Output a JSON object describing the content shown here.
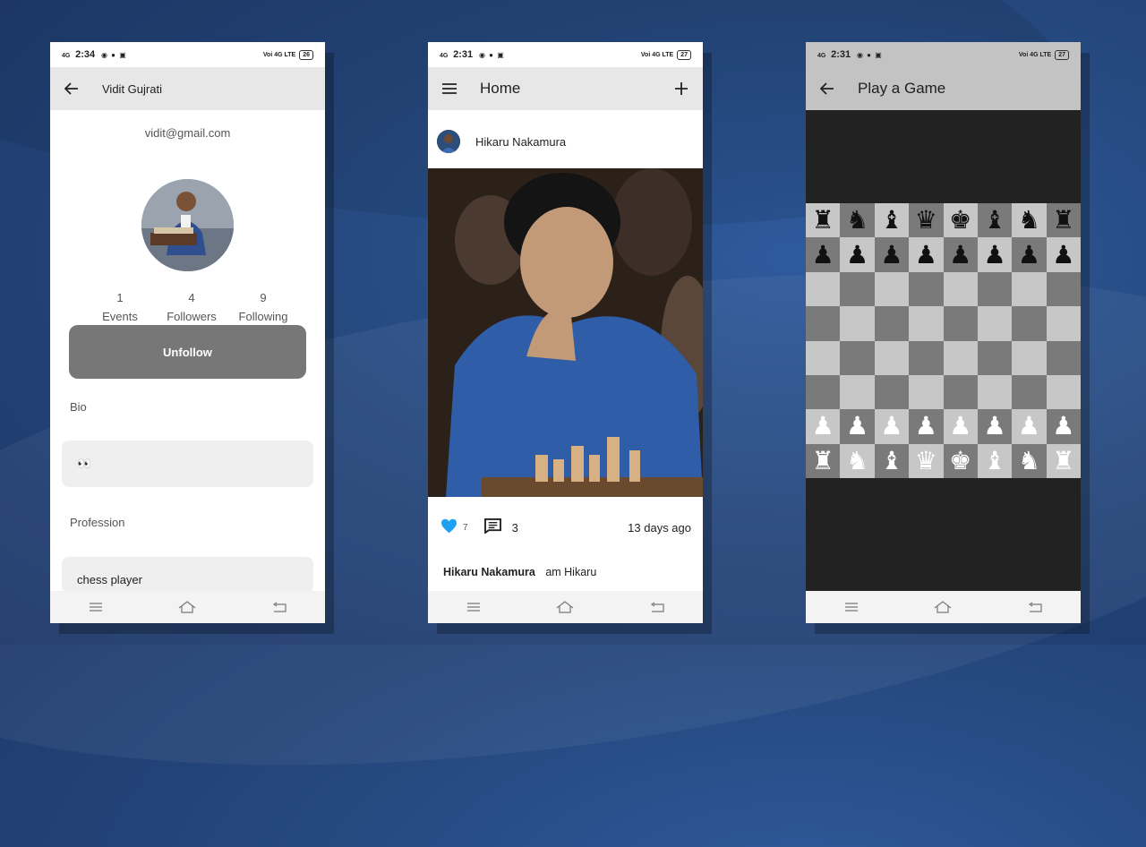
{
  "status_bars": [
    {
      "network": "4G",
      "time": "2:34",
      "right": "Voi 4G LTE",
      "battery": "26"
    },
    {
      "network": "4G",
      "time": "2:31",
      "right": "Voi 4G LTE",
      "battery": "27"
    },
    {
      "network": "4G",
      "time": "2:31",
      "right": "Voi 4G LTE",
      "battery": "27"
    }
  ],
  "profile": {
    "title": "Vidit Gujrati",
    "email": "vidit@gmail.com",
    "stats": [
      {
        "value": "1",
        "label": "Events"
      },
      {
        "value": "4",
        "label": "Followers"
      },
      {
        "value": "9",
        "label": "Following"
      }
    ],
    "unfollow_label": "Unfollow",
    "bio_label": "Bio",
    "bio_value": "👀",
    "profession_label": "Profession",
    "profession_value": "chess player"
  },
  "home": {
    "title": "Home",
    "post": {
      "author": "Hikaru Nakamura",
      "likes": "7",
      "comments": "3",
      "time_ago": "13 days ago",
      "caption_author": "Hikaru Nakamura",
      "caption_text": "am Hikaru"
    }
  },
  "game": {
    "title": "Play a Game",
    "board": [
      [
        "♜",
        "♞",
        "♝",
        "♛",
        "♚",
        "♝",
        "♞",
        "♜"
      ],
      [
        "♟",
        "♟",
        "♟",
        "♟",
        "♟",
        "♟",
        "♟",
        "♟"
      ],
      [
        "",
        "",
        "",
        "",
        "",
        "",
        "",
        ""
      ],
      [
        "",
        "",
        "",
        "",
        "",
        "",
        "",
        ""
      ],
      [
        "",
        "",
        "",
        "",
        "",
        "",
        "",
        ""
      ],
      [
        "",
        "",
        "",
        "",
        "",
        "",
        "",
        ""
      ],
      [
        "♟",
        "♟",
        "♟",
        "♟",
        "♟",
        "♟",
        "♟",
        "♟"
      ],
      [
        "♜",
        "♞",
        "♝",
        "♛",
        "♚",
        "♝",
        "♞",
        "♜"
      ]
    ]
  },
  "colors": {
    "like_blue": "#1ea1f2",
    "button_gray": "#777777",
    "board_light": "#c7c7c7",
    "board_dark": "#7a7a7a"
  }
}
